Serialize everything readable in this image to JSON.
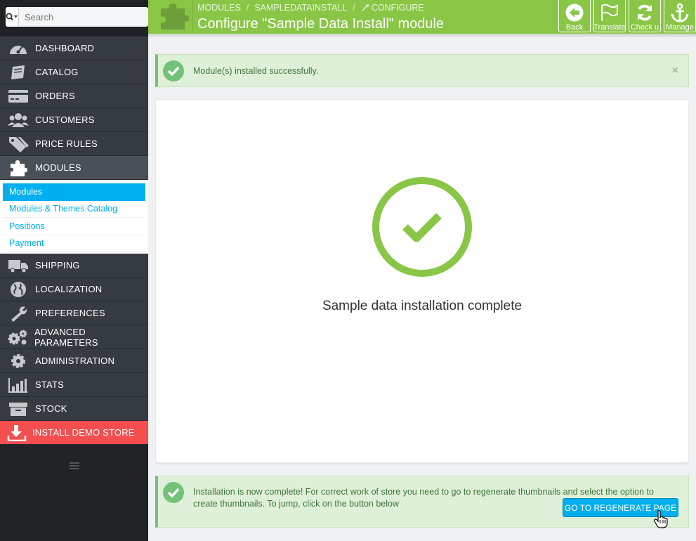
{
  "search": {
    "placeholder": "Search"
  },
  "sidebar": {
    "items": [
      {
        "label": "DASHBOARD"
      },
      {
        "label": "CATALOG"
      },
      {
        "label": "ORDERS"
      },
      {
        "label": "CUSTOMERS"
      },
      {
        "label": "PRICE RULES"
      },
      {
        "label": "MODULES"
      }
    ],
    "submenu": [
      {
        "label": "Modules"
      },
      {
        "label": "Modules & Themes Catalog"
      },
      {
        "label": "Positions"
      },
      {
        "label": "Payment"
      }
    ],
    "items_after": [
      {
        "label": "SHIPPING"
      },
      {
        "label": "LOCALIZATION"
      },
      {
        "label": "PREFERENCES"
      },
      {
        "label": "ADVANCED PARAMETERS"
      },
      {
        "label": "ADMINISTRATION"
      },
      {
        "label": "STATS"
      },
      {
        "label": "STOCK"
      }
    ],
    "demo": {
      "label": "INSTALL DEMO STORE"
    }
  },
  "header": {
    "breadcrumb": [
      "MODULES",
      "SAMPLEDATAINSTALL",
      "CONFIGURE"
    ],
    "title": "Configure \"Sample Data Install\" module",
    "toolbar": [
      {
        "label": "Back"
      },
      {
        "label": "Translate"
      },
      {
        "label": "Check u"
      },
      {
        "label": "Manage"
      }
    ]
  },
  "alerts": {
    "success": "Module(s) installed successfully.",
    "close": "×",
    "complete": "Installation is now complete! For correct work of store you need to go to regenerate thumbnails and select the option to create thumbnails. To jump, click on the button below"
  },
  "main": {
    "message": "Sample data installation complete",
    "button": "GO TO REGENERATE PAGE"
  },
  "colors": {
    "header_green": "#89c646",
    "sidebar_dark": "#363a41",
    "accent_blue": "#00aff0",
    "demo_red": "#f54e4e",
    "success_bg": "#dff0d8"
  }
}
